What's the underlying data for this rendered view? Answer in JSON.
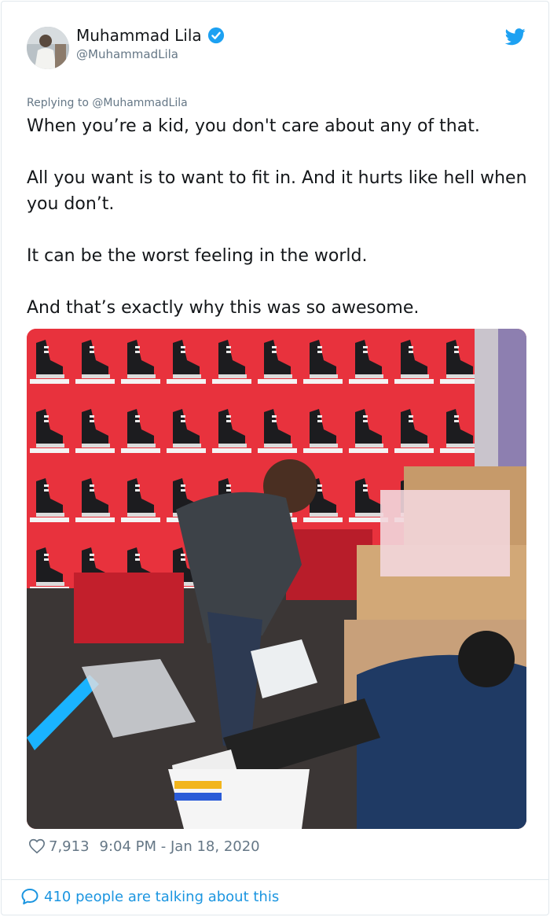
{
  "author": {
    "name": "Muhammad Lila",
    "handle": "@MuhammadLila",
    "verified": true
  },
  "reply_to": "Replying to @MuhammadLila",
  "tweet": {
    "paragraphs": [
      "When you’re a kid, you don't care about any of that.",
      "All you want is to want to fit in.  And it hurts like hell when you don’t.",
      "It can be the worst feeling in the world.",
      "And that’s exactly why this was so awesome."
    ]
  },
  "photo": {
    "description_icon": "photo"
  },
  "stats": {
    "likes": "7,913",
    "timestamp": "9:04 PM - Jan 18, 2020"
  },
  "footer": {
    "talking": "410 people are talking about this"
  },
  "colors": {
    "twitter_blue": "#1da1f2",
    "link_blue": "#1b95e0",
    "secondary_text": "#657786",
    "skate_wall_red": "#e8323d"
  }
}
